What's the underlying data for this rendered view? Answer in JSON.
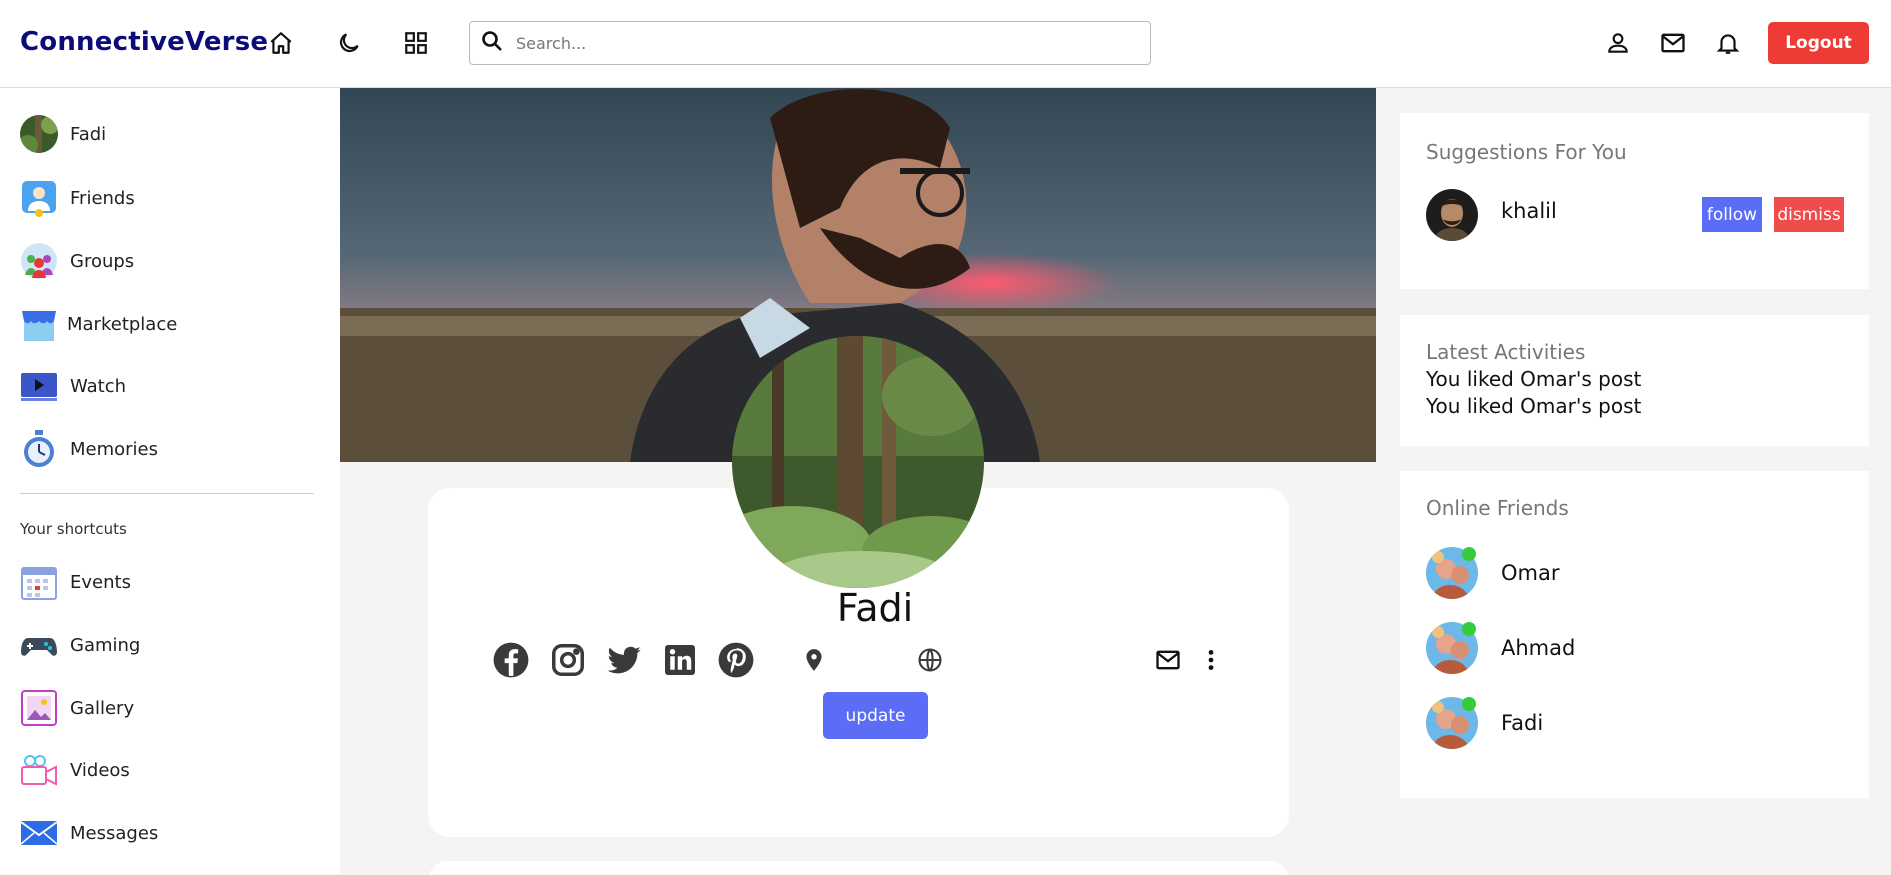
{
  "navbar": {
    "logo": "ConnectiveVerse",
    "search_placeholder": "Search...",
    "logout_label": "Logout",
    "icons": [
      "home-icon",
      "moon-icon",
      "grid-icon",
      "search-icon",
      "person-icon",
      "mail-icon",
      "bell-icon"
    ]
  },
  "sidebar": {
    "items": [
      {
        "label": "Fadi",
        "icon": "user-avatar"
      },
      {
        "label": "Friends",
        "icon": "friends-icon"
      },
      {
        "label": "Groups",
        "icon": "groups-icon"
      },
      {
        "label": "Marketplace",
        "icon": "marketplace-icon"
      },
      {
        "label": "Watch",
        "icon": "watch-icon"
      },
      {
        "label": "Memories",
        "icon": "memories-icon"
      }
    ],
    "shortcuts_title": "Your shortcuts",
    "shortcuts": [
      {
        "label": "Events",
        "icon": "calendar-icon"
      },
      {
        "label": "Gaming",
        "icon": "gamepad-icon"
      },
      {
        "label": "Gallery",
        "icon": "gallery-icon"
      },
      {
        "label": "Videos",
        "icon": "video-camera-icon"
      },
      {
        "label": "Messages",
        "icon": "envelope-icon"
      }
    ]
  },
  "profile": {
    "name": "Fadi",
    "update_label": "update",
    "social_icons": [
      "facebook-icon",
      "instagram-icon",
      "twitter-icon",
      "linkedin-icon",
      "pinterest-icon",
      "location-pin-icon",
      "globe-icon",
      "mail-icon",
      "more-vertical-icon"
    ]
  },
  "suggestions": {
    "title": "Suggestions For You",
    "user": "khalil",
    "follow_label": "follow",
    "dismiss_label": "dismiss"
  },
  "activities": {
    "title": "Latest Activities",
    "items": [
      "You liked Omar's post",
      "You liked Omar's post"
    ]
  },
  "online_friends": {
    "title": "Online Friends",
    "friends": [
      "Omar",
      "Ahmad",
      "Fadi"
    ]
  },
  "colors": {
    "brand": "#0b0b7a",
    "logout": "#ef3b36",
    "primary_button": "#5b6cf6",
    "dismiss": "#ef4c4c",
    "online": "#35cc3c",
    "background": "#f6f3f3"
  }
}
